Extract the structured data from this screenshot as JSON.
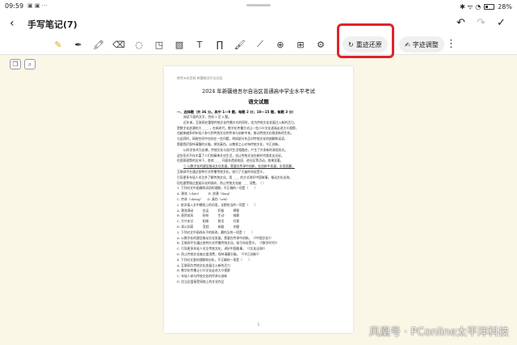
{
  "status": {
    "time": "09:59",
    "icons_left": "▣ ▣ ···",
    "icons_right": "✱ ᯤ ◔",
    "battery": "28%"
  },
  "titlebar": {
    "back_icon": "‹",
    "title": "手写笔记(7)",
    "undo_icon": "↶",
    "redo_icon": "↷",
    "done_icon": "✓"
  },
  "toolbar": {
    "tools": [
      {
        "name": "magic-pen-icon",
        "glyph": "✎"
      },
      {
        "name": "pen-icon",
        "glyph": "✒"
      },
      {
        "name": "highlighter-icon",
        "glyph": "🖍"
      },
      {
        "name": "eraser-icon",
        "glyph": "⌫"
      },
      {
        "name": "lasso-icon",
        "glyph": "◌"
      },
      {
        "name": "shape-icon",
        "glyph": "◳"
      },
      {
        "name": "image-icon",
        "glyph": "▨"
      },
      {
        "name": "text-icon",
        "glyph": "T"
      },
      {
        "name": "formula-icon",
        "glyph": "∏"
      },
      {
        "name": "brush-icon",
        "glyph": "🖌"
      },
      {
        "name": "ruler-icon",
        "glyph": "⟋"
      },
      {
        "name": "zoom-icon",
        "glyph": "⊕"
      },
      {
        "name": "add-page-icon",
        "glyph": "⊞"
      },
      {
        "name": "settings-icon",
        "glyph": "⚙"
      }
    ],
    "restore_icon": "↻",
    "restore_label": "重迹还原",
    "adjust_icon": "✍",
    "adjust_label": "字迹调整",
    "more_icon": "⋮"
  },
  "side": {
    "pages_icon": "❐",
    "search_icon": "⌕"
  },
  "document": {
    "header": "绝密★启用前 新疆维吾尔自治区",
    "title": "2024 年新疆维吾尔自治区普通高中学业水平考试",
    "subtitle": "语文试题",
    "section": "一、选择题（共 36 分。其中 1—9 题，每题 2 分；10—15 题，每题 3 分）",
    "lines": [
      "阅读下面的文字，完成 1 至 5 题。",
      "近年来，互联网在重塑传统文化传播方式的同时，也为传统文化发展注入新的活力。",
      "是数字化浪潮的大 ____ ，在新时代，数字化传播方式让一些小众文化逐渐走进大众视野，",
      "也越来越多的年轻人参与到传统文化的传承与创新中来，推动传统文化焕发新的生机。",
      "与此同时，网络空间中也存在一些问题，例如部分作品对传统文化的曲解和误读，",
      "需要我们保持清醒的头脑，辨别真伪，以敬畏之心对待传统文化，守正创新。",
      "以科学技术为支撑，传统文化与现代生活相融合，产生了许多新的表现形式。",
      "这些形式不仅丰富了人们的精神文化生活，也让传统文化在新时代焕发出光彩。",
      "在国家政策的支持下，各地 ____ 开展非遗进校园、进社区等活动，效果显著。",
      "① 以数字化的建设推动文化发展，需要在传承中创新，在创新中发展，实现双赢。",
      "互联网平台通过各种方式传播传统文化，吸引了大量的年轻受众，",
      "引导更多年轻人关注并了解传统文化，用 ____ 的方式讲好中国故事，推动文化出海。",
      "但也要警惕过度娱乐化的倾向，防止传统文化被 ____ 消费。（ ）",
      "1. 下列对文中画横线词语的理解，不正确的一项是（　　）",
      "A. 潮流（cháo）　　　B. 浪潮（làng）",
      "C. 传承（chéng）　　D. 真伪（wěi）",
      "2. 依次填入文中横线上的词语，全都恰当的一项是（　　）",
      "A. 潮流涌动　　　应运　　　积极　　　肆意",
      "B. 蔚然成风　　　纷纷　　　生动　　　随意",
      "C. 方兴未艾　　　相继　　　鲜活　　　任意",
      "D. 如火如荼　　　竞相　　　新颖　　　刻意",
      "3. 下列对文中画线句子的修改，最恰当的一项是（　　）",
      "A. 以数字化的建设推动文化发展，需要在传承中创新。（《中国文化》）",
      "B. 互联网平台通过各种方式传播传统文化，吸引年轻受众。（《数字时代》）",
      "C. 引导更多年轻人关注传统文化，讲好中国故事。（《文化出海》）",
      "D. 防止传统文化被过度消费，保持清醒头脑。（《守正创新》）",
      "4. 下列对文意的理解和分析，不正确的一项是（　　）",
      "A. 互联网为传统文化发展注入新的活力",
      "B. 数字化传播让小众文化走进大众视野",
      "C. 年轻人参与传统文化的传承与创新",
      "D. 应当全盘接受网络上的文化作品"
    ],
    "page_number": "1"
  },
  "watermark": "风凰号 · PConline太平洋科技"
}
